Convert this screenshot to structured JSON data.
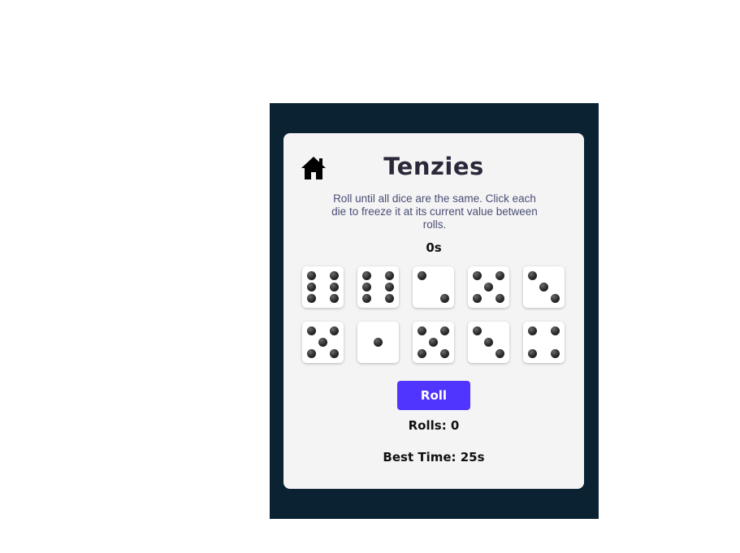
{
  "game": {
    "title": "Tenzies",
    "description": "Roll until all dice are the same. Click each die to freeze it at its current value between rolls.",
    "timer": "0s",
    "roll_label": "Roll",
    "rolls": "Rolls: 0",
    "best_time": "Best Time: 25s"
  },
  "dice": [
    6,
    6,
    2,
    5,
    3,
    5,
    1,
    5,
    3,
    4
  ],
  "colors": {
    "background": "#0b2233",
    "card": "#f4f4f4",
    "accent": "#5035ff",
    "title": "#2b283a"
  },
  "icons": {
    "home": "home-icon"
  }
}
